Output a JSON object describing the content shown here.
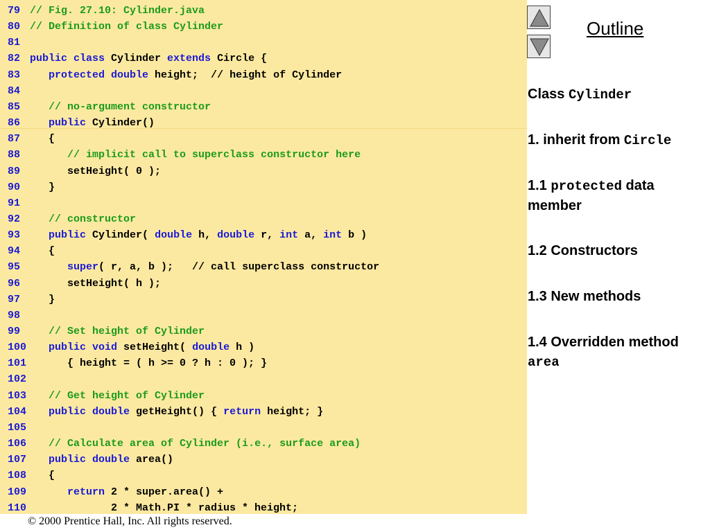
{
  "code": {
    "line_numbers": [
      "79",
      "80",
      "81",
      "82",
      "83",
      "84",
      "85",
      "86",
      "87",
      "88",
      "89",
      "90",
      "91",
      "92",
      "93",
      "94",
      "95",
      "96",
      "97",
      "98",
      "99",
      "100",
      "101",
      "102",
      "103",
      "104",
      "105",
      "106",
      "107",
      "108",
      "109",
      "110"
    ],
    "lines": [
      [
        {
          "t": "// Fig. 27.10: Cylinder.java",
          "c": "cm"
        }
      ],
      [
        {
          "t": "// Definition of class Cylinder",
          "c": "cm"
        }
      ],
      [],
      [
        {
          "t": "public class",
          "c": "kw"
        },
        {
          "t": " Cylinder ",
          "c": ""
        },
        {
          "t": "extends",
          "c": "kw"
        },
        {
          "t": " Circle {",
          "c": ""
        }
      ],
      [
        {
          "t": "   ",
          "c": ""
        },
        {
          "t": "protected double",
          "c": "kw"
        },
        {
          "t": " height;  // height of Cylinder",
          "c": ""
        }
      ],
      [],
      [
        {
          "t": "   ",
          "c": ""
        },
        {
          "t": "// no-argument constructor",
          "c": "cm"
        }
      ],
      [
        {
          "t": "   ",
          "c": ""
        },
        {
          "t": "public",
          "c": "kw"
        },
        {
          "t": " Cylinder()",
          "c": ""
        }
      ],
      [
        {
          "t": "   {",
          "c": ""
        }
      ],
      [
        {
          "t": "      ",
          "c": ""
        },
        {
          "t": "// implicit call to superclass constructor here",
          "c": "cm"
        }
      ],
      [
        {
          "t": "      setHeight( 0 );",
          "c": ""
        }
      ],
      [
        {
          "t": "   }",
          "c": ""
        }
      ],
      [],
      [
        {
          "t": "   ",
          "c": ""
        },
        {
          "t": "// constructor",
          "c": "cm"
        }
      ],
      [
        {
          "t": "   ",
          "c": ""
        },
        {
          "t": "public",
          "c": "kw"
        },
        {
          "t": " Cylinder( ",
          "c": ""
        },
        {
          "t": "double",
          "c": "kw"
        },
        {
          "t": " h, ",
          "c": ""
        },
        {
          "t": "double",
          "c": "kw"
        },
        {
          "t": " r, ",
          "c": ""
        },
        {
          "t": "int",
          "c": "kw"
        },
        {
          "t": " a, ",
          "c": ""
        },
        {
          "t": "int",
          "c": "kw"
        },
        {
          "t": " b )",
          "c": ""
        }
      ],
      [
        {
          "t": "   {",
          "c": ""
        }
      ],
      [
        {
          "t": "      ",
          "c": ""
        },
        {
          "t": "super",
          "c": "kw"
        },
        {
          "t": "( r, a, b );   // call superclass constructor",
          "c": ""
        }
      ],
      [
        {
          "t": "      setHeight( h );",
          "c": ""
        }
      ],
      [
        {
          "t": "   }",
          "c": ""
        }
      ],
      [],
      [
        {
          "t": "   ",
          "c": ""
        },
        {
          "t": "// Set height of Cylinder",
          "c": "cm"
        }
      ],
      [
        {
          "t": "   ",
          "c": ""
        },
        {
          "t": "public void",
          "c": "kw"
        },
        {
          "t": " setHeight( ",
          "c": ""
        },
        {
          "t": "double",
          "c": "kw"
        },
        {
          "t": " h )",
          "c": ""
        }
      ],
      [
        {
          "t": "      { height = ( h >= 0 ? h : 0 ); }",
          "c": ""
        }
      ],
      [],
      [
        {
          "t": "   ",
          "c": ""
        },
        {
          "t": "// Get height of Cylinder",
          "c": "cm"
        }
      ],
      [
        {
          "t": "   ",
          "c": ""
        },
        {
          "t": "public double",
          "c": "kw"
        },
        {
          "t": " getHeight() { ",
          "c": ""
        },
        {
          "t": "return",
          "c": "kw"
        },
        {
          "t": " height; }",
          "c": ""
        }
      ],
      [],
      [
        {
          "t": "   ",
          "c": ""
        },
        {
          "t": "// Calculate area of Cylinder (i.e., surface area)",
          "c": "cm"
        }
      ],
      [
        {
          "t": "   ",
          "c": ""
        },
        {
          "t": "public double",
          "c": "kw"
        },
        {
          "t": " area()",
          "c": ""
        }
      ],
      [
        {
          "t": "   {",
          "c": ""
        }
      ],
      [
        {
          "t": "      ",
          "c": ""
        },
        {
          "t": "return",
          "c": "kw"
        },
        {
          "t": " 2 * super.area() +",
          "c": ""
        }
      ],
      [
        {
          "t": "             2 * Math.PI * radius * height;",
          "c": ""
        }
      ]
    ]
  },
  "nav": {
    "up_icon": "triangle-up-icon",
    "down_icon": "triangle-down-icon"
  },
  "outline": {
    "title": "Outline",
    "items": [
      [
        {
          "t": "Class ",
          "m": false
        },
        {
          "t": "Cylinder",
          "m": true
        }
      ],
      [
        {
          "t": "1. inherit from ",
          "m": false
        },
        {
          "t": "Circle",
          "m": true
        }
      ],
      [
        {
          "t": "1.1 ",
          "m": false
        },
        {
          "t": "protected",
          "m": true
        },
        {
          "t": " data member",
          "m": false
        }
      ],
      [
        {
          "t": "1.2 Constructors",
          "m": false
        }
      ],
      [
        {
          "t": "1.3 New methods",
          "m": false
        }
      ],
      [
        {
          "t": "1.4 Overridden method ",
          "m": false
        },
        {
          "t": "area",
          "m": true
        }
      ]
    ]
  },
  "footer": {
    "copyright": "© 2000 Prentice Hall, Inc.  All rights reserved."
  },
  "colors": {
    "code_background": "#fce9a1",
    "keyword": "#1a1ad6",
    "comment": "#1c9b1c",
    "line_number": "#1a1ad6"
  }
}
